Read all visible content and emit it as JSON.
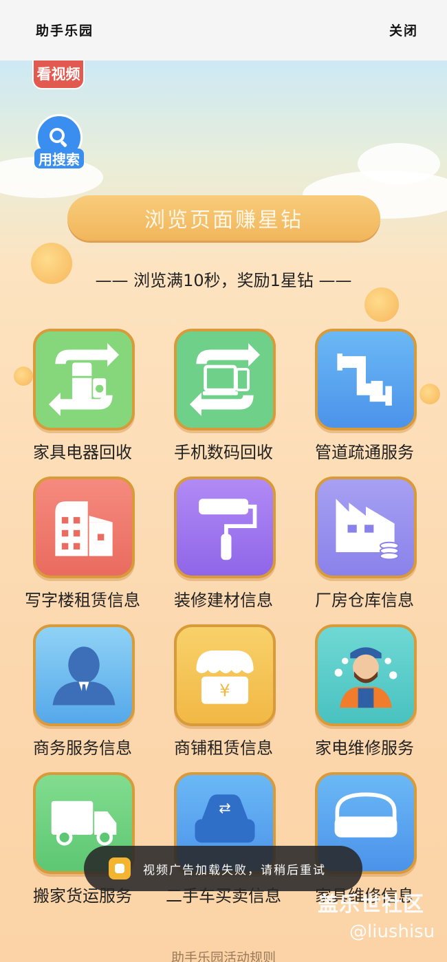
{
  "topbar": {
    "title": "助手乐园",
    "close": "关闭"
  },
  "badges": {
    "watch_video": "看视频",
    "use_search": "用搜索"
  },
  "main_button": "浏览页面赚星钻",
  "subtitle": "—— 浏览满10秒，奖励1星钻 ——",
  "services": [
    {
      "label": "家具电器回收",
      "icon": "appliance-recycle-icon",
      "color": "#7fd27a"
    },
    {
      "label": "手机数码回收",
      "icon": "digital-recycle-icon",
      "color": "#6fd08a"
    },
    {
      "label": "管道疏通服务",
      "icon": "pipe-icon",
      "color": "#5aa6f0"
    },
    {
      "label": "写字楼租赁信息",
      "icon": "office-building-icon",
      "color": "#f2776c"
    },
    {
      "label": "装修建材信息",
      "icon": "paint-roller-icon",
      "color": "#a57bf0"
    },
    {
      "label": "厂房仓库信息",
      "icon": "factory-icon",
      "color": "#9b93ee"
    },
    {
      "label": "商务服务信息",
      "icon": "business-person-icon",
      "color": "#64b4ee"
    },
    {
      "label": "商铺租赁信息",
      "icon": "shop-icon",
      "color": "#f5c45a"
    },
    {
      "label": "家电维修服务",
      "icon": "repairman-icon",
      "color": "#5bcfcf"
    },
    {
      "label": "搬家货运服务",
      "icon": "truck-icon",
      "color": "#6fd08a"
    },
    {
      "label": "二手车买卖信息",
      "icon": "car-icon",
      "color": "#5aa6f0"
    },
    {
      "label": "家具维修信息",
      "icon": "sofa-repair-icon",
      "color": "#5aa6f0"
    }
  ],
  "toast": "视频广告加载失败，请稍后重试",
  "footer": {
    "rules": "助手乐园活动规则"
  },
  "watermark": {
    "line1": "盖乐世社区",
    "line2": "@liushisu"
  }
}
